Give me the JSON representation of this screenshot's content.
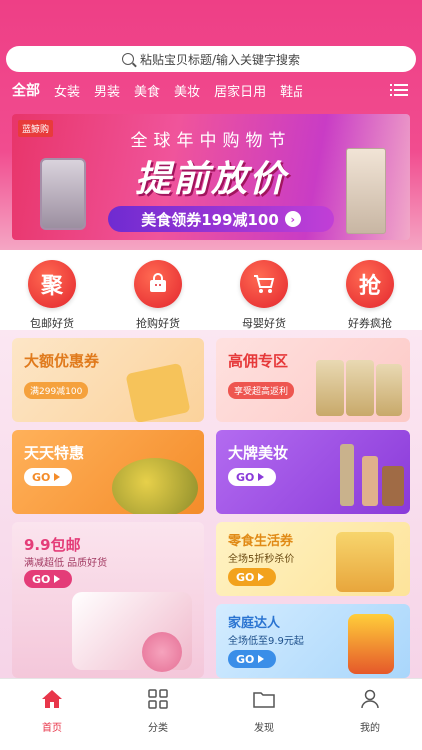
{
  "search": {
    "placeholder": "粘贴宝贝标题/输入关键字搜索"
  },
  "tabs": [
    "全部",
    "女装",
    "男装",
    "美食",
    "美妆",
    "居家日用",
    "鞋品"
  ],
  "banner": {
    "brand": "蓝鲸购",
    "line1": "全球年中购物节",
    "line2": "提前放价",
    "line3": "美食领券199减100"
  },
  "categories": [
    {
      "icon_char": "聚",
      "label": "包邮好货"
    },
    {
      "icon_char": "",
      "label": "抢购好货",
      "icon": "bag-icon"
    },
    {
      "icon_char": "",
      "label": "母婴好货",
      "icon": "cart-icon"
    },
    {
      "icon_char": "抢",
      "label": "好券疯抢"
    }
  ],
  "cards": {
    "coupon": {
      "title": "大额优惠券",
      "tag": "满299减100"
    },
    "commission": {
      "title": "高佣专区",
      "tag": "享受超高返利"
    },
    "daily": {
      "title": "天天特惠",
      "go": "GO"
    },
    "beauty": {
      "title": "大牌美妆",
      "go": "GO"
    },
    "nine": {
      "title": "9.9包邮",
      "sub": "满减超低  品质好货",
      "go": "GO"
    },
    "snack": {
      "title": "零食生活券",
      "sub": "全场5折秒杀价",
      "go": "GO"
    },
    "home": {
      "title": "家庭达人",
      "sub": "全场低至9.9元起",
      "go": "GO"
    }
  },
  "tabbar": [
    "首页",
    "分类",
    "发现",
    "我的"
  ],
  "colors": {
    "accent": "#ee3f86",
    "active_tab": "#e8364a"
  }
}
